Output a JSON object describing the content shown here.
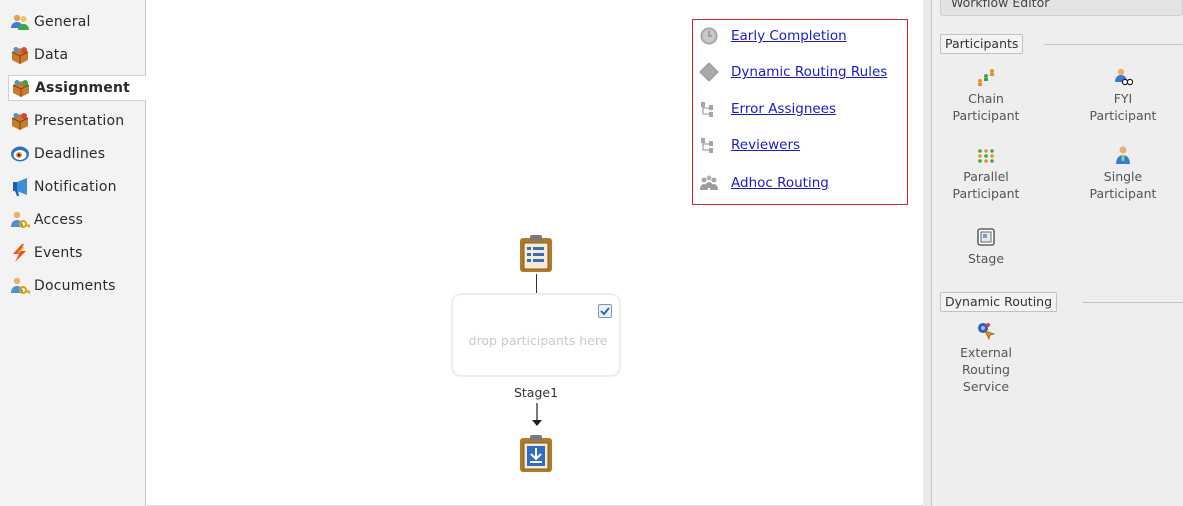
{
  "sidebar": {
    "items": [
      {
        "label": "General",
        "icon": "users-icon"
      },
      {
        "label": "Data",
        "icon": "package-icon"
      },
      {
        "label": "Assignment",
        "icon": "package-icon",
        "active": true
      },
      {
        "label": "Presentation",
        "icon": "package-icon"
      },
      {
        "label": "Deadlines",
        "icon": "clock-eye-icon"
      },
      {
        "label": "Notification",
        "icon": "megaphone-icon"
      },
      {
        "label": "Access",
        "icon": "user-key-icon"
      },
      {
        "label": "Events",
        "icon": "lightning-icon"
      },
      {
        "label": "Documents",
        "icon": "user-key-icon"
      }
    ]
  },
  "advanced": {
    "links": [
      {
        "label": "Early Completion",
        "icon": "clock-icon"
      },
      {
        "label": "Dynamic Routing Rules",
        "icon": "diamond-icon"
      },
      {
        "label": "Error Assignees",
        "icon": "hierarchy-icon"
      },
      {
        "label": "Reviewers",
        "icon": "hierarchy-icon"
      },
      {
        "label": "Adhoc Routing",
        "icon": "group-icon"
      }
    ]
  },
  "flow": {
    "stage_hint": "drop participants here",
    "stage_name": "Stage1"
  },
  "palette": {
    "title": "Workflow Editor",
    "participants_header": "Participants",
    "participants": [
      {
        "label_lines": [
          "Chain",
          "Participant"
        ],
        "icon": "chain-icon"
      },
      {
        "label_lines": [
          "FYI",
          "Participant"
        ],
        "icon": "fyi-icon"
      },
      {
        "label_lines": [
          "Parallel",
          "Participant"
        ],
        "icon": "parallel-icon"
      },
      {
        "label_lines": [
          "Single",
          "Participant"
        ],
        "icon": "single-user-icon"
      },
      {
        "label_lines": [
          "Stage"
        ],
        "icon": "stage-icon"
      }
    ],
    "dynamic_header": "Dynamic Routing",
    "dynamic": [
      {
        "label_lines": [
          "External",
          "Routing",
          "Service"
        ],
        "icon": "routing-service-icon"
      }
    ]
  },
  "colors": {
    "link": "#1a1acc",
    "highlight_border": "#d81e1e",
    "sidebar_bg": "#f3f3f3",
    "palette_bg": "#eeeeee"
  }
}
